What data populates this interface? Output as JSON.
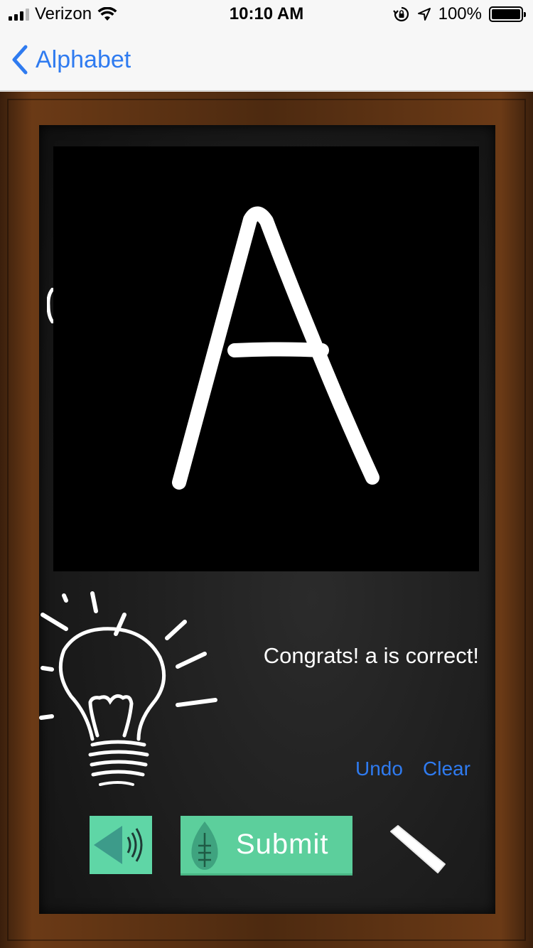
{
  "status_bar": {
    "carrier": "Verizon",
    "time": "10:10 AM",
    "battery": "100%"
  },
  "nav": {
    "back_label": "Alphabet"
  },
  "canvas": {
    "drawn_letter": "A",
    "background": "#000000",
    "stroke_color": "#ffffff"
  },
  "feedback": {
    "message": "Congrats! a is correct!"
  },
  "controls": {
    "undo_label": "Undo",
    "clear_label": "Clear",
    "submit_label": "Submit",
    "sound_icon": "speaker-icon",
    "chalk_icon": "chalk-icon"
  },
  "colors": {
    "accent_blue": "#2f7bf0",
    "button_green": "#5ccf9c",
    "frame_brown": "#4d2a10"
  }
}
